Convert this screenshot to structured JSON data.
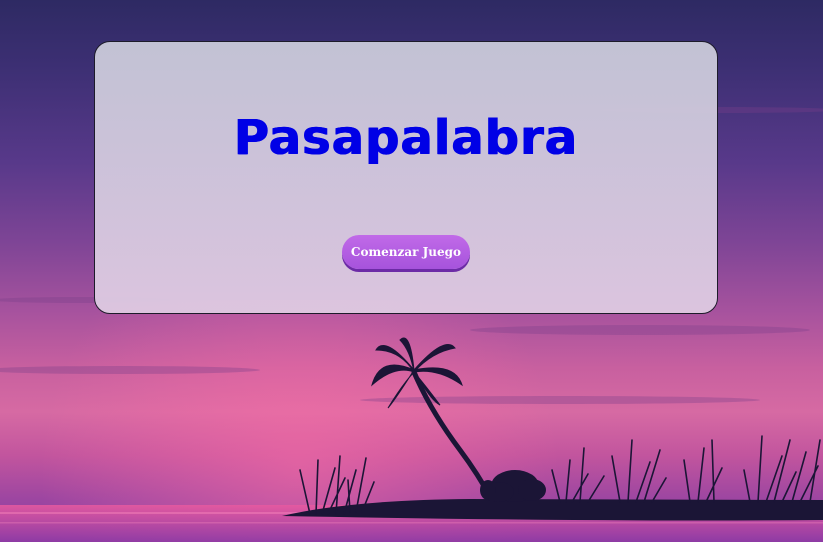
{
  "game": {
    "title": "Pasapalabra",
    "start_button_label": "Comenzar Juego"
  },
  "colors": {
    "title": "#0000e6",
    "button": "#b35ee3",
    "sky_top": "#2e2a63",
    "horizon": "#d66aa3"
  },
  "background": {
    "scene": "tropical sunset with palm tree on island"
  }
}
